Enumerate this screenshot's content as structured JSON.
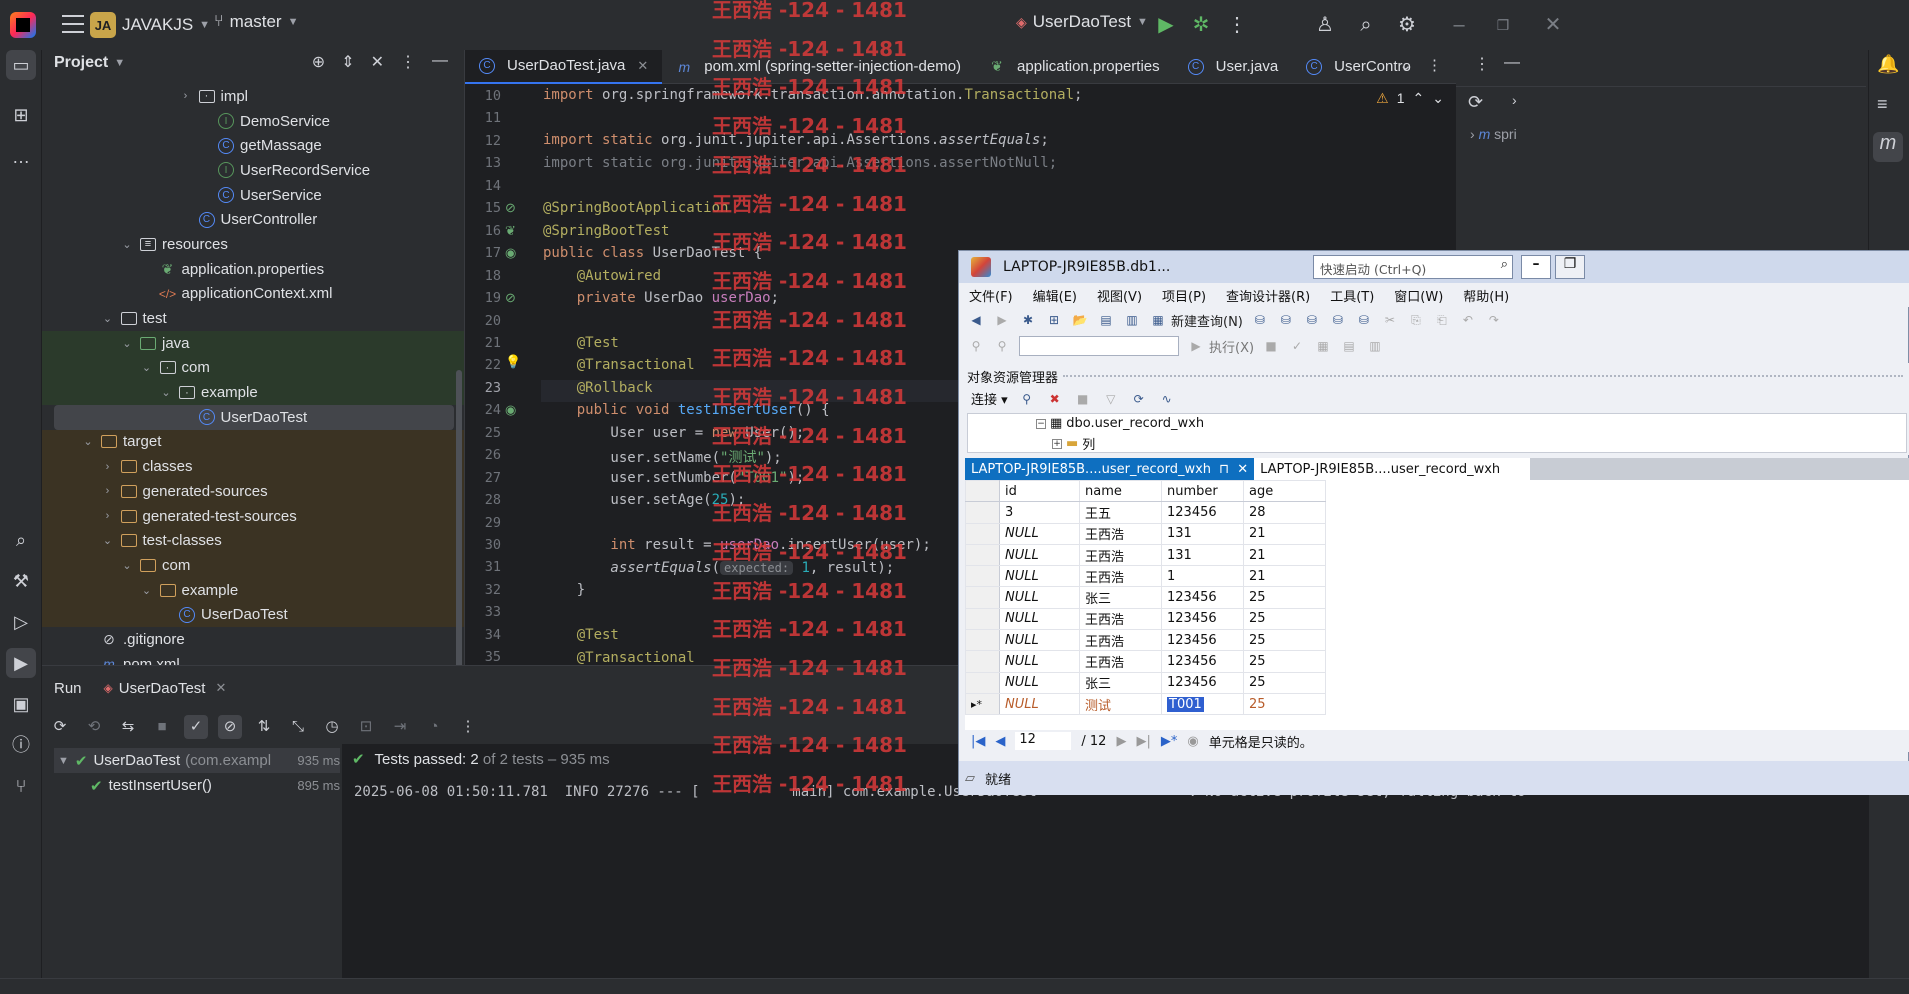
{
  "titlebar": {
    "project_badge": "JA",
    "project_name": "JAVAKJS",
    "branch": "master",
    "run_config": "UserDaoTest"
  },
  "project_panel": {
    "title": "Project",
    "tree": [
      {
        "label": "impl",
        "indent": 7,
        "icon": "package-folder-icon",
        "arrow": ">"
      },
      {
        "label": "DemoService",
        "indent": 8,
        "icon": "interface-icon"
      },
      {
        "label": "getMassage",
        "indent": 8,
        "icon": "class-icon"
      },
      {
        "label": "UserRecordService",
        "indent": 8,
        "icon": "interface-icon"
      },
      {
        "label": "UserService",
        "indent": 8,
        "icon": "class-icon"
      },
      {
        "label": "UserController",
        "indent": 7,
        "icon": "class-icon"
      },
      {
        "label": "resources",
        "indent": 4,
        "icon": "resources-folder-icon",
        "arrow": "v"
      },
      {
        "label": "application.properties",
        "indent": 5,
        "icon": "spring-leaf-icon"
      },
      {
        "label": "applicationContext.xml",
        "indent": 5,
        "icon": "xml-icon"
      },
      {
        "label": "test",
        "indent": 3,
        "icon": "folder-icon",
        "arrow": "v"
      },
      {
        "label": "java",
        "indent": 4,
        "icon": "test-folder-icon",
        "arrow": "v",
        "bg": "test"
      },
      {
        "label": "com",
        "indent": 5,
        "icon": "package-folder-icon",
        "arrow": "v",
        "bg": "test"
      },
      {
        "label": "example",
        "indent": 6,
        "icon": "package-folder-icon",
        "arrow": "v",
        "bg": "test"
      },
      {
        "label": "UserDaoTest",
        "indent": 7,
        "icon": "test-class-icon",
        "selected": true
      },
      {
        "label": "target",
        "indent": 2,
        "icon": "excluded-folder-icon",
        "arrow": "v",
        "bg": "target"
      },
      {
        "label": "classes",
        "indent": 3,
        "icon": "excluded-folder-icon",
        "arrow": ">",
        "bg": "target"
      },
      {
        "label": "generated-sources",
        "indent": 3,
        "icon": "excluded-folder-icon",
        "arrow": ">",
        "bg": "target"
      },
      {
        "label": "generated-test-sources",
        "indent": 3,
        "icon": "excluded-folder-icon",
        "arrow": ">",
        "bg": "target"
      },
      {
        "label": "test-classes",
        "indent": 3,
        "icon": "excluded-folder-icon",
        "arrow": "v",
        "bg": "target"
      },
      {
        "label": "com",
        "indent": 4,
        "icon": "excluded-folder-icon",
        "arrow": "v",
        "bg": "target"
      },
      {
        "label": "example",
        "indent": 5,
        "icon": "excluded-folder-icon",
        "arrow": "v",
        "bg": "target"
      },
      {
        "label": "UserDaoTest",
        "indent": 6,
        "icon": "test-class-icon",
        "bg": "target"
      },
      {
        "label": ".gitignore",
        "indent": 2,
        "icon": "ignore-file-icon"
      },
      {
        "label": "pom.xml",
        "indent": 2,
        "icon": "maven-icon"
      }
    ]
  },
  "editor": {
    "tabs": [
      {
        "label": "UserDaoTest.java",
        "icon": "test-class-icon",
        "active": true,
        "closable": true
      },
      {
        "label": "pom.xml (spring-setter-injection-demo)",
        "icon": "maven-icon"
      },
      {
        "label": "application.properties",
        "icon": "spring-leaf-icon"
      },
      {
        "label": "User.java",
        "icon": "class-icon"
      },
      {
        "label": "UserContro",
        "icon": "class-icon"
      }
    ],
    "warnings": "1",
    "current_line": "23",
    "line_numbers": [
      "10",
      "11",
      "12",
      "13",
      "14",
      "15",
      "16",
      "17",
      "18",
      "19",
      "20",
      "21",
      "22",
      "23",
      "24",
      "25",
      "26",
      "27",
      "28",
      "29",
      "30",
      "31",
      "32",
      "33",
      "34",
      "35"
    ]
  },
  "code": {
    "l10_kw": "import ",
    "l10_pkg": "org.springframework.transaction.annotation.",
    "l10_cls": "Transactional",
    "l10_end": ";",
    "l12_kw": "import static ",
    "l12_pkg": "org.junit.jupiter.api.Assertions.",
    "l12_fn": "assertEquals",
    "l12_end": ";",
    "l13": "import static org.junit.jupiter.api.Assertions.assertNotNull;",
    "l15": "@SpringBootApplication",
    "l16": "@SpringBootTest",
    "l17_kw": "public class ",
    "l17_rest": "UserDaoTest {",
    "l18": "    @Autowired",
    "l19_kw": "    private ",
    "l19_type": "UserDao ",
    "l19_fd": "userDao",
    "l19_end": ";",
    "l21": "    @Test",
    "l22": "    @Transactional",
    "l23": "    @Rollback",
    "l24_kw": "    public void ",
    "l24_fn": "testInsertUser",
    "l24_end": "() {",
    "l25_a": "        User user = ",
    "l25_kw": "new ",
    "l25_b": "User();",
    "l26_a": "        user.setName(",
    "l26_s": "\"测试\"",
    "l26_b": ");",
    "l27_a": "        user.setNumber(",
    "l27_s": "\"T001\"",
    "l27_b": ");",
    "l28_a": "        user.setAge(",
    "l28_n": "25",
    "l28_b": ");",
    "l30_kw": "        int ",
    "l30_a": "result = ",
    "l30_fd": "userDao",
    "l30_b": ".insertUser(user);",
    "l31_fn": "        assertEquals",
    "l31_a": "(",
    "l31_hint": "expected:",
    "l31_n": " 1",
    "l31_b": ", result);",
    "l32": "    }",
    "l34": "    @Test",
    "l35": "    @Transactional"
  },
  "watermark": "王西浩 -124 - 1481",
  "run": {
    "tab_run": "Run",
    "tab_config": "UserDaoTest",
    "results": [
      {
        "name": "UserDaoTest",
        "detail": "(com.exampl",
        "time": "935 ms"
      },
      {
        "name": "testInsertUser()",
        "detail": "",
        "time": "895 ms"
      }
    ],
    "passed_label": "Tests passed: 2",
    "passed_detail": " of 2 tests – 935 ms",
    "log_line": "2025-06-08 01:50:11.781  INFO 27276 --- [           main] com.example.UserDaoTest                  : No active profile set, falling back to"
  },
  "ssms": {
    "title": "LAPTOP-JR9IE85B.db1...",
    "quick_launch": "快速启动 (Ctrl+Q)",
    "menu": [
      "文件(F)",
      "编辑(E)",
      "视图(V)",
      "项目(P)",
      "查询设计器(R)",
      "工具(T)",
      "窗口(W)",
      "帮助(H)"
    ],
    "new_query": "新建查询(N)",
    "execute": "执行(X)",
    "object_explorer": "对象资源管理器",
    "connect": "连接",
    "tree_table": "dbo.user_record_wxh",
    "tree_columns": "列",
    "doc_tab_active": "LAPTOP-JR9IE85B....user_record_wxh",
    "doc_tab_inactive": "LAPTOP-JR9IE85B....user_record_wxh",
    "grid": {
      "columns": [
        "id",
        "name",
        "number",
        "age"
      ],
      "rows": [
        [
          "3",
          "王五",
          "123456",
          "28"
        ],
        [
          "NULL",
          "王西浩",
          "131",
          "21"
        ],
        [
          "NULL",
          "王西浩",
          "131",
          "21"
        ],
        [
          "NULL",
          "王西浩",
          "1",
          "21"
        ],
        [
          "NULL",
          "张三",
          "123456",
          "25"
        ],
        [
          "NULL",
          "王西浩",
          "123456",
          "25"
        ],
        [
          "NULL",
          "王西浩",
          "123456",
          "25"
        ],
        [
          "NULL",
          "王西浩",
          "123456",
          "25"
        ],
        [
          "NULL",
          "张三",
          "123456",
          "25"
        ]
      ],
      "new_row": {
        "marker": "▸*",
        "id": "NULL",
        "name": "测试",
        "number": "T001",
        "age": "25"
      }
    },
    "nav_current": "12",
    "nav_total": "/ 12",
    "readonly_msg": "单元格是只读的。",
    "status": "就绪"
  }
}
